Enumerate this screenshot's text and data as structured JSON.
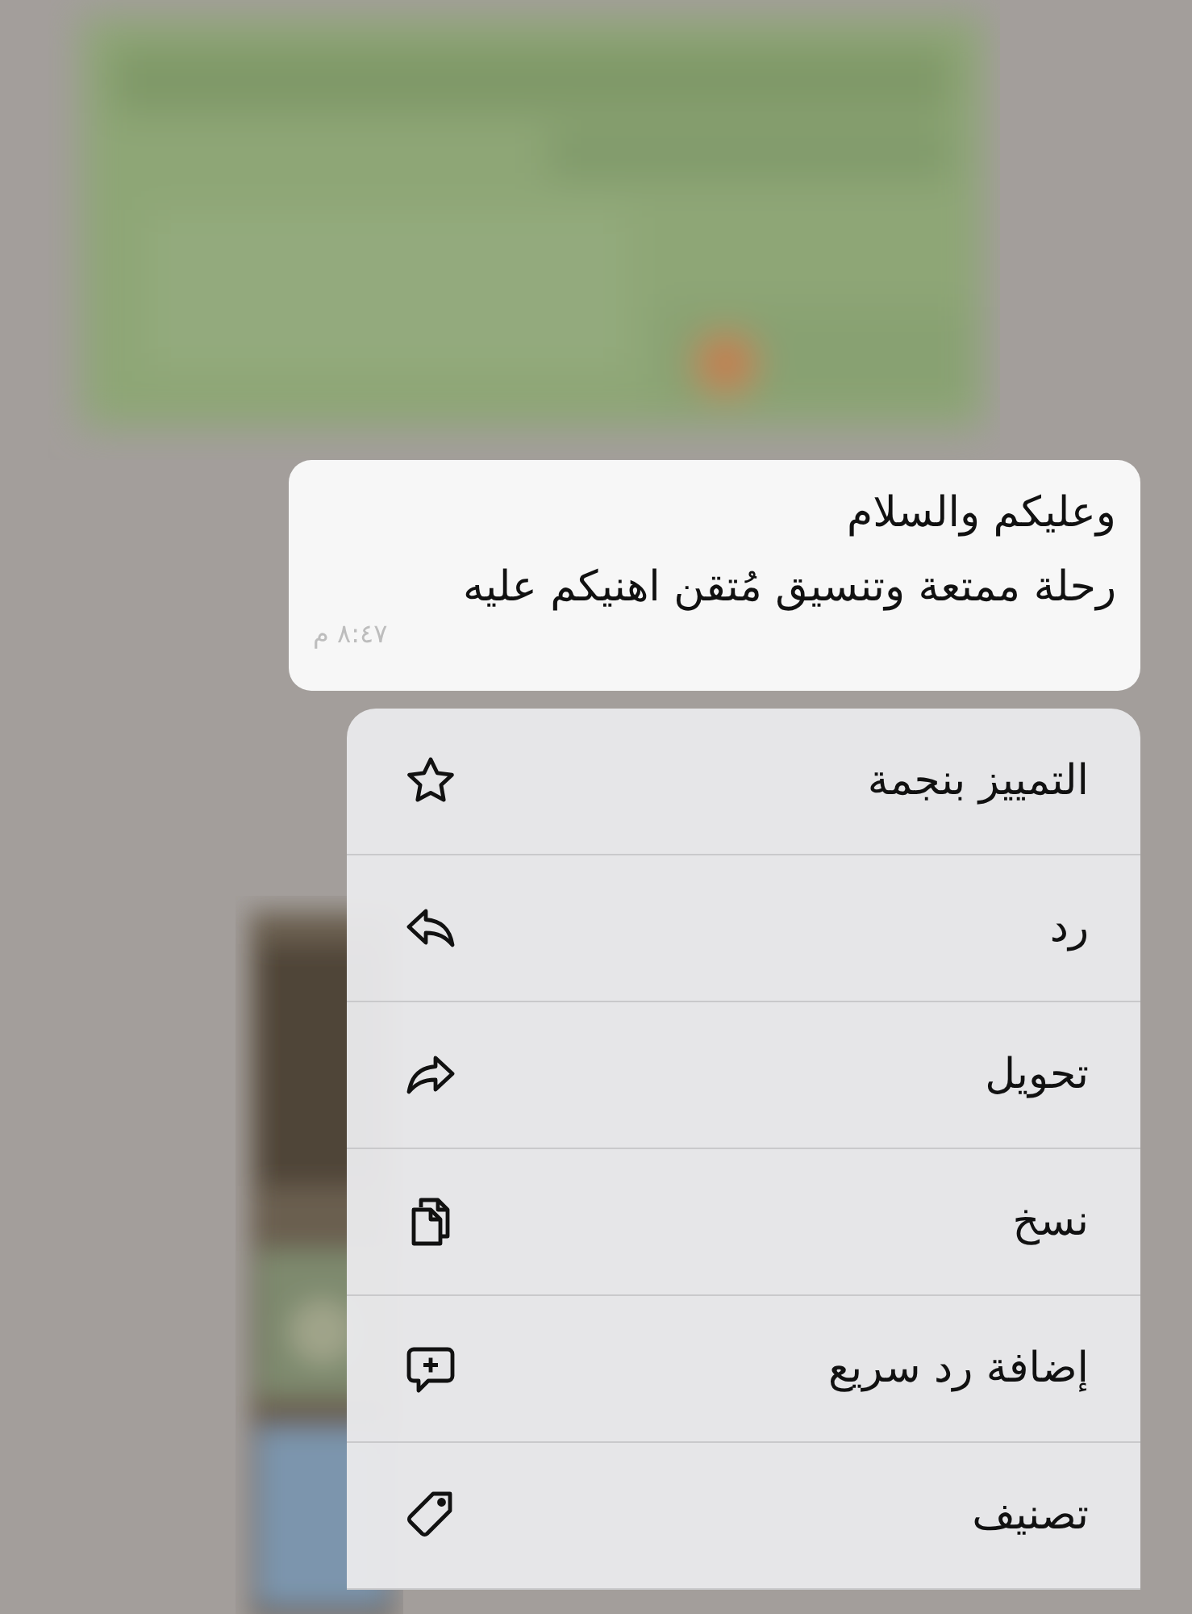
{
  "message": {
    "lines": [
      "وعليكم والسلام",
      "رحلة ممتعة وتنسيق مُتقن اهنيكم عليه"
    ],
    "time": "٨:٤٧ م"
  },
  "menu": {
    "items": [
      {
        "label": "التمييز بنجمة",
        "kind": "star"
      },
      {
        "label": "رد",
        "kind": "reply"
      },
      {
        "label": "تحويل",
        "kind": "forward"
      },
      {
        "label": "نسخ",
        "kind": "copy"
      },
      {
        "label": "إضافة رد سريع",
        "kind": "quick-reply"
      },
      {
        "label": "تصنيف",
        "kind": "tag"
      }
    ]
  }
}
